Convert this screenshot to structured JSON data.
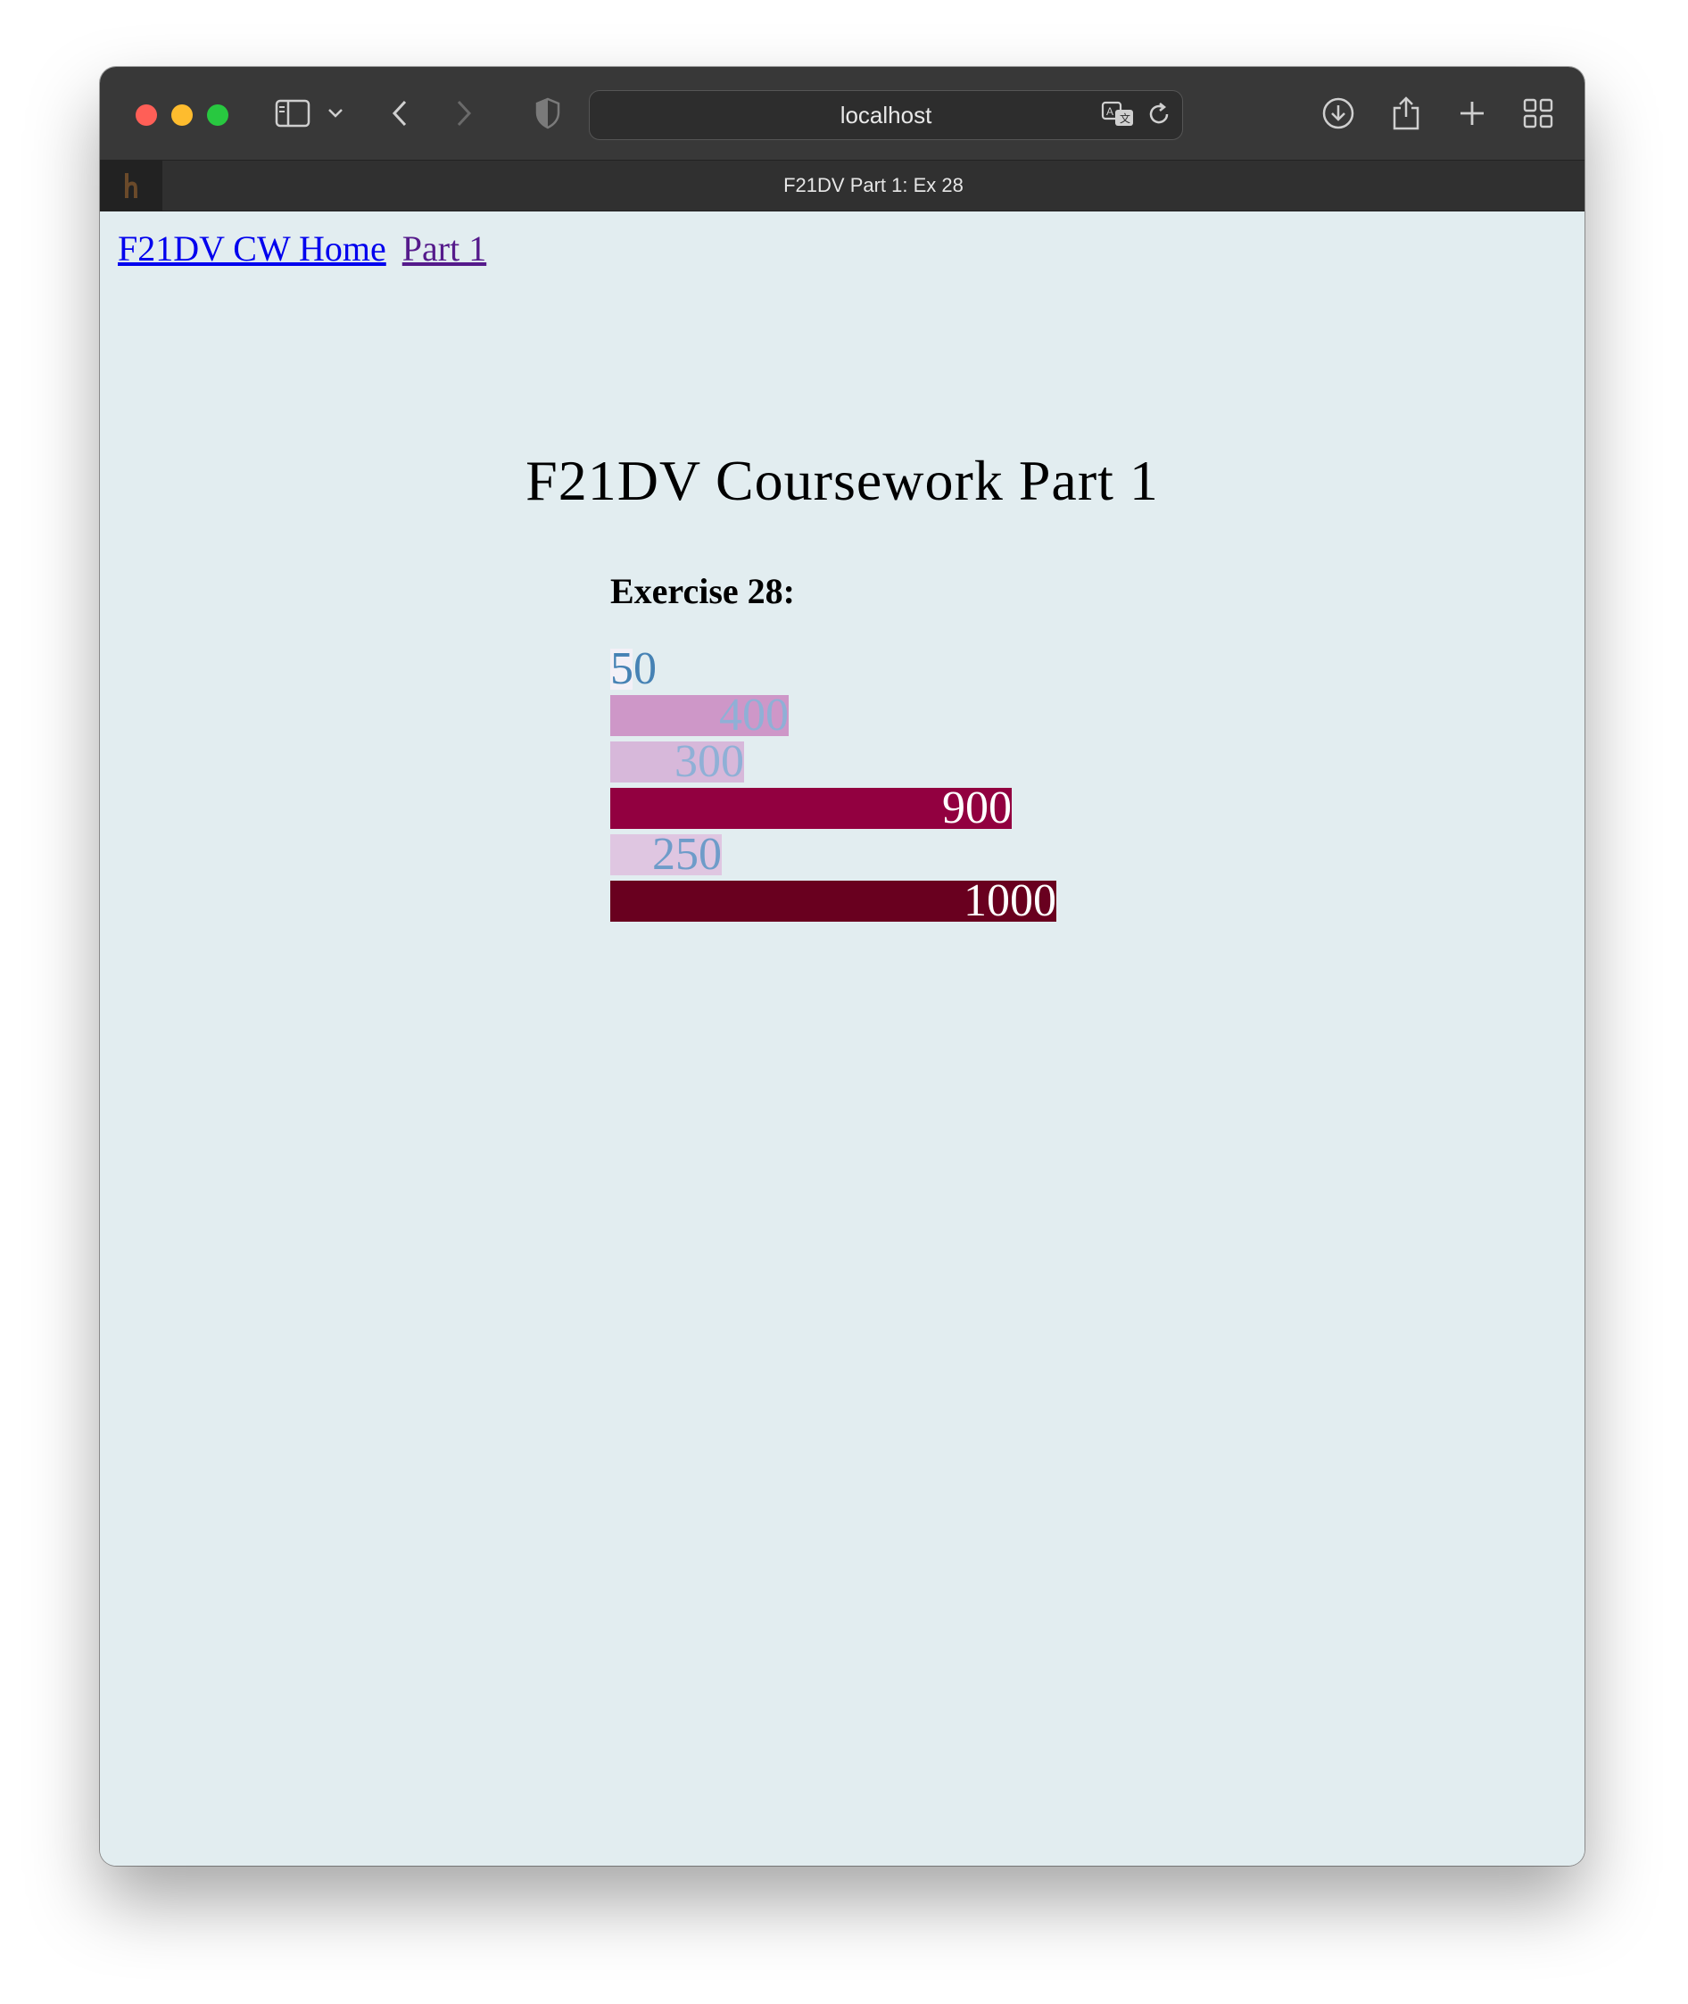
{
  "browser": {
    "url_host": "localhost",
    "tab_title": "F21DV Part 1: Ex 28",
    "icons": [
      "sidebar-icon",
      "chevron-down-icon",
      "back-icon",
      "forward-icon",
      "shield-icon",
      "translate-icon",
      "reload-icon",
      "download-icon",
      "share-icon",
      "new-tab-icon",
      "tab-overview-icon"
    ]
  },
  "page": {
    "nav": {
      "home_link": "F21DV CW Home",
      "part_link": "Part 1"
    },
    "title": "F21DV Coursework Part 1",
    "exercise_heading": "Exercise 28:"
  },
  "chart_data": {
    "type": "bar",
    "orientation": "horizontal",
    "values": [
      50,
      400,
      300,
      900,
      250,
      1000
    ],
    "labels": [
      "50",
      "400",
      "300",
      "900",
      "250",
      "1000"
    ],
    "colors": [
      "#f3f0f7",
      "#ce97c8",
      "#d7b8da",
      "#920040",
      "#dfc6e1",
      "#69001f"
    ],
    "label_colors": [
      "#4682b4",
      "#8fb0d6",
      "#8fb0d6",
      "#ffffff",
      "#6e9cc9",
      "#ffffff"
    ]
  }
}
